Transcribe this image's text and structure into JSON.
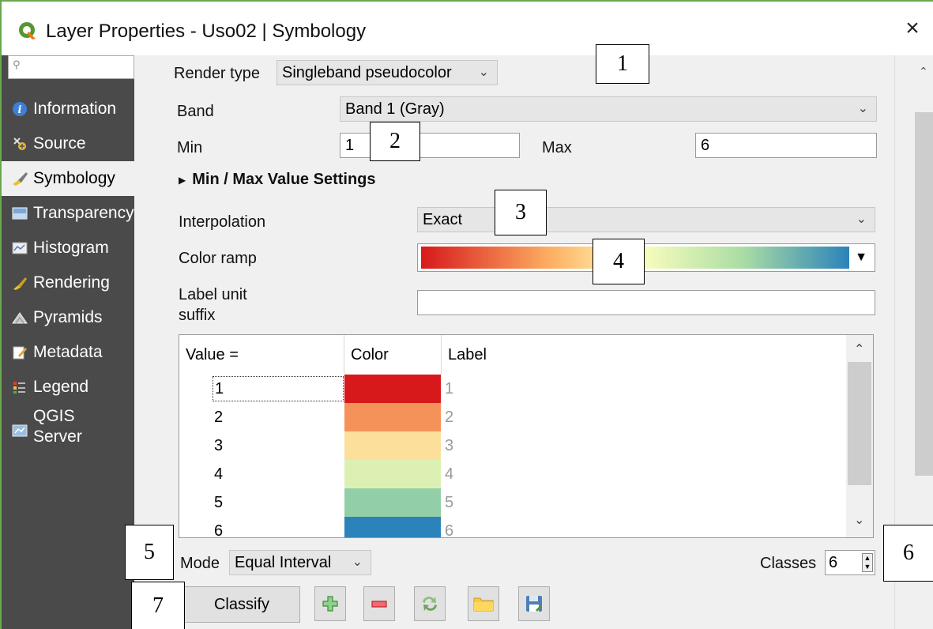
{
  "window": {
    "title": "Layer Properties - Uso02 | Symbology",
    "close_glyph": "×"
  },
  "sidebar": {
    "search_placeholder": "",
    "items": [
      {
        "label": "Information",
        "icon": "info-icon"
      },
      {
        "label": "Source",
        "icon": "source-icon"
      },
      {
        "label": "Symbology",
        "icon": "brush-icon",
        "selected": true
      },
      {
        "label": "Transparency",
        "icon": "transparency-icon"
      },
      {
        "label": "Histogram",
        "icon": "histogram-icon"
      },
      {
        "label": "Rendering",
        "icon": "rendering-icon"
      },
      {
        "label": "Pyramids",
        "icon": "pyramids-icon"
      },
      {
        "label": "Metadata",
        "icon": "metadata-icon"
      },
      {
        "label": "Legend",
        "icon": "legend-icon"
      },
      {
        "label": "QGIS",
        "label2": "Server",
        "icon": "server-icon"
      }
    ]
  },
  "symbology": {
    "render_type_label": "Render type",
    "render_type_value": "Singleband pseudocolor",
    "band_label": "Band",
    "band_value": "Band 1 (Gray)",
    "min_label": "Min",
    "min_value": "1",
    "max_label": "Max",
    "max_value": "6",
    "minmax_settings_label": "Min / Max Value Settings",
    "interpolation_label": "Interpolation",
    "interpolation_value": "Exact",
    "color_ramp_label": "Color ramp",
    "label_unit_suffix_label_line1": "Label unit",
    "label_unit_suffix_label_line2": "suffix",
    "label_unit_suffix_value": ""
  },
  "table": {
    "headers": {
      "value": "Value =",
      "color": "Color",
      "label": "Label"
    },
    "rows": [
      {
        "value": "1",
        "color": "#d7191c",
        "label": "1"
      },
      {
        "value": "2",
        "color": "#f4925a",
        "label": "2"
      },
      {
        "value": "3",
        "color": "#fddf9c",
        "label": "3"
      },
      {
        "value": "4",
        "color": "#dcf0b4",
        "label": "4"
      },
      {
        "value": "5",
        "color": "#92cfa8",
        "label": "5"
      },
      {
        "value": "6",
        "color": "#2b83ba",
        "label": "6"
      }
    ]
  },
  "bottom": {
    "mode_label": "Mode",
    "mode_value": "Equal Interval",
    "classes_label": "Classes",
    "classes_value": "6",
    "classify_label": "Classify"
  },
  "callouts": [
    "1",
    "2",
    "3",
    "4",
    "5",
    "6",
    "7"
  ]
}
